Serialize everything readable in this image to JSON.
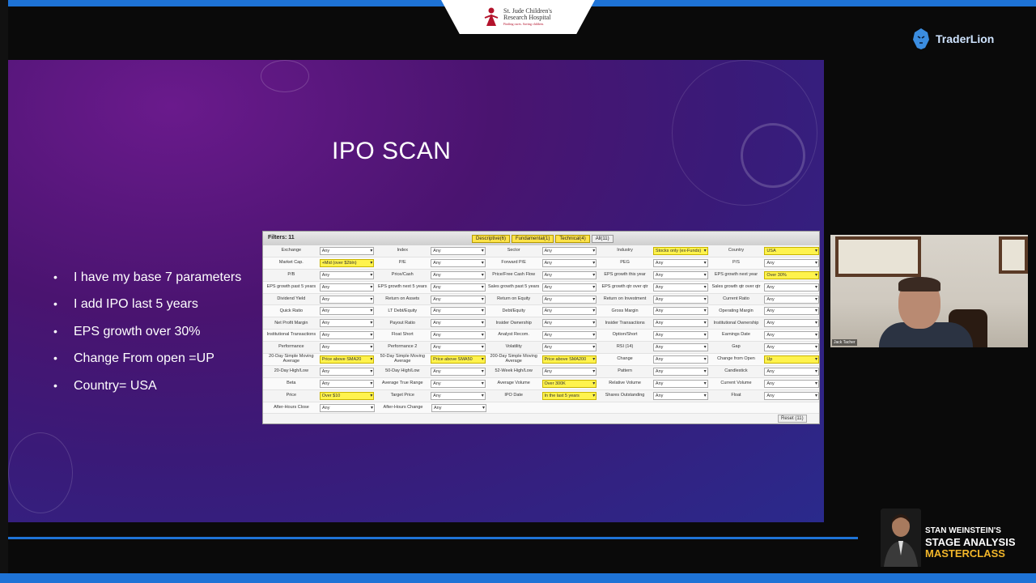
{
  "sponsor": {
    "line1": "St. Jude Children's",
    "line2": "Research Hospital",
    "tagline": "Finding cures. Saving children."
  },
  "brand": {
    "name": "TraderLion"
  },
  "slide": {
    "title": "IPO SCAN",
    "bullets": [
      "I have my base 7 parameters",
      "I add IPO last 5 years",
      "EPS growth over 30%",
      "Change From open =UP",
      "Country= USA"
    ]
  },
  "screener": {
    "filters_label": "Filters: 11",
    "tabs": [
      "Descriptive(6)",
      "Fundamental(1)",
      "Technical(4)",
      "All(11)"
    ],
    "reset_label": "Reset (11)",
    "rows": [
      [
        [
          "Exchange",
          "Any",
          false
        ],
        [
          "Index",
          "Any",
          false
        ],
        [
          "Sector",
          "Any",
          false
        ],
        [
          "Industry",
          "Stocks only (ex-Funds)",
          true
        ],
        [
          "Country",
          "USA",
          true
        ]
      ],
      [
        [
          "Market Cap.",
          "+Mid (over $2bln)",
          true
        ],
        [
          "P/E",
          "Any",
          false
        ],
        [
          "Forward P/E",
          "Any",
          false
        ],
        [
          "PEG",
          "Any",
          false
        ],
        [
          "P/S",
          "Any",
          false
        ]
      ],
      [
        [
          "P/B",
          "Any",
          false
        ],
        [
          "Price/Cash",
          "Any",
          false
        ],
        [
          "Price/Free Cash Flow",
          "Any",
          false
        ],
        [
          "EPS growth this year",
          "Any",
          false
        ],
        [
          "EPS growth next year",
          "Over 30%",
          true
        ]
      ],
      [
        [
          "EPS growth past 5 years",
          "Any",
          false
        ],
        [
          "EPS growth next 5 years",
          "Any",
          false
        ],
        [
          "Sales growth past 5 years",
          "Any",
          false
        ],
        [
          "EPS growth qtr over qtr",
          "Any",
          false
        ],
        [
          "Sales growth qtr over qtr",
          "Any",
          false
        ]
      ],
      [
        [
          "Dividend Yield",
          "Any",
          false
        ],
        [
          "Return on Assets",
          "Any",
          false
        ],
        [
          "Return on Equity",
          "Any",
          false
        ],
        [
          "Return on Investment",
          "Any",
          false
        ],
        [
          "Current Ratio",
          "Any",
          false
        ]
      ],
      [
        [
          "Quick Ratio",
          "Any",
          false
        ],
        [
          "LT Debt/Equity",
          "Any",
          false
        ],
        [
          "Debt/Equity",
          "Any",
          false
        ],
        [
          "Gross Margin",
          "Any",
          false
        ],
        [
          "Operating Margin",
          "Any",
          false
        ]
      ],
      [
        [
          "Net Profit Margin",
          "Any",
          false
        ],
        [
          "Payout Ratio",
          "Any",
          false
        ],
        [
          "Insider Ownership",
          "Any",
          false
        ],
        [
          "Insider Transactions",
          "Any",
          false
        ],
        [
          "Institutional Ownership",
          "Any",
          false
        ]
      ],
      [
        [
          "Institutional Transactions",
          "Any",
          false
        ],
        [
          "Float Short",
          "Any",
          false
        ],
        [
          "Analyst Recom.",
          "Any",
          false
        ],
        [
          "Option/Short",
          "Any",
          false
        ],
        [
          "Earnings Date",
          "Any",
          false
        ]
      ],
      [
        [
          "Performance",
          "Any",
          false
        ],
        [
          "Performance 2",
          "Any",
          false
        ],
        [
          "Volatility",
          "Any",
          false
        ],
        [
          "RSI (14)",
          "Any",
          false
        ],
        [
          "Gap",
          "Any",
          false
        ]
      ],
      [
        [
          "20-Day Simple Moving Average",
          "Price above SMA20",
          true
        ],
        [
          "50-Day Simple Moving Average",
          "Price above SMA50",
          true
        ],
        [
          "200-Day Simple Moving Average",
          "Price above SMA200",
          true
        ],
        [
          "Change",
          "Any",
          false
        ],
        [
          "Change from Open",
          "Up",
          true
        ]
      ],
      [
        [
          "20-Day High/Low",
          "Any",
          false
        ],
        [
          "50-Day High/Low",
          "Any",
          false
        ],
        [
          "52-Week High/Low",
          "Any",
          false
        ],
        [
          "Pattern",
          "Any",
          false
        ],
        [
          "Candlestick",
          "Any",
          false
        ]
      ],
      [
        [
          "Beta",
          "Any",
          false
        ],
        [
          "Average True Range",
          "Any",
          false
        ],
        [
          "Average Volume",
          "Over 300K",
          true
        ],
        [
          "Relative Volume",
          "Any",
          false
        ],
        [
          "Current Volume",
          "Any",
          false
        ]
      ],
      [
        [
          "Price",
          "Over $10",
          true
        ],
        [
          "Target Price",
          "Any",
          false
        ],
        [
          "IPO Date",
          "In the last 5 years",
          true
        ],
        [
          "Shares Outstanding",
          "Any",
          false
        ],
        [
          "Float",
          "Any",
          false
        ]
      ],
      [
        [
          "After-Hours Close",
          "Any",
          false
        ],
        [
          "After-Hours Change",
          "Any",
          false
        ]
      ]
    ]
  },
  "webcam": {
    "name_label": "Jack Tacher"
  },
  "masterclass": {
    "line1": "STAN WEINSTEIN'S",
    "line2": "STAGE ANALYSIS",
    "line3": "MASTERCLASS"
  },
  "colors": {
    "accent_blue": "#1e73d6",
    "highlight_yellow": "#fff34d",
    "gold": "#f2b62a"
  }
}
